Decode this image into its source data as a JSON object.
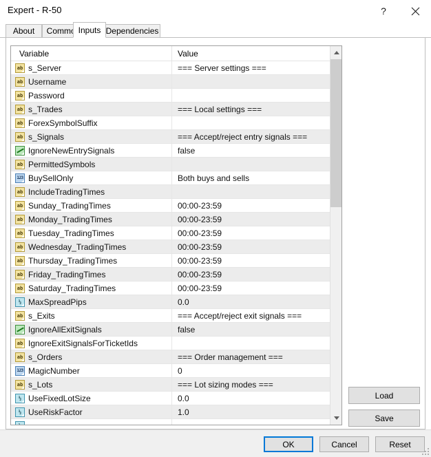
{
  "window": {
    "title": "Expert - R-50",
    "help_label": "?",
    "close_label": "✕",
    "help_icon": "question-mark-icon",
    "close_icon": "close-icon"
  },
  "tabs": [
    {
      "label": "About",
      "active": false
    },
    {
      "label": "Common",
      "active": false
    },
    {
      "label": "Inputs",
      "active": true
    },
    {
      "label": "Dependencies",
      "active": false
    }
  ],
  "list": {
    "columns": [
      "Variable",
      "Value"
    ],
    "rows": [
      {
        "type": "string",
        "name": "s_Server",
        "value": "=== Server settings ==="
      },
      {
        "type": "string",
        "name": "Username",
        "value": ""
      },
      {
        "type": "string",
        "name": "Password",
        "value": ""
      },
      {
        "type": "string",
        "name": "s_Trades",
        "value": "=== Local settings ==="
      },
      {
        "type": "string",
        "name": "ForexSymbolSuffix",
        "value": ""
      },
      {
        "type": "string",
        "name": "s_Signals",
        "value": "=== Accept/reject entry signals ==="
      },
      {
        "type": "bool",
        "name": "IgnoreNewEntrySignals",
        "value": "false"
      },
      {
        "type": "string",
        "name": "PermittedSymbols",
        "value": ""
      },
      {
        "type": "int",
        "name": "BuySellOnly",
        "value": "Both buys and sells"
      },
      {
        "type": "string",
        "name": "IncludeTradingTimes",
        "value": ""
      },
      {
        "type": "string",
        "name": "Sunday_TradingTimes",
        "value": "00:00-23:59"
      },
      {
        "type": "string",
        "name": "Monday_TradingTimes",
        "value": "00:00-23:59"
      },
      {
        "type": "string",
        "name": "Tuesday_TradingTimes",
        "value": "00:00-23:59"
      },
      {
        "type": "string",
        "name": "Wednesday_TradingTimes",
        "value": "00:00-23:59"
      },
      {
        "type": "string",
        "name": "Thursday_TradingTimes",
        "value": "00:00-23:59"
      },
      {
        "type": "string",
        "name": "Friday_TradingTimes",
        "value": "00:00-23:59"
      },
      {
        "type": "string",
        "name": "Saturday_TradingTimes",
        "value": "00:00-23:59"
      },
      {
        "type": "double",
        "name": "MaxSpreadPips",
        "value": "0.0"
      },
      {
        "type": "string",
        "name": "s_Exits",
        "value": "=== Accept/reject exit signals ==="
      },
      {
        "type": "bool",
        "name": "IgnoreAllExitSignals",
        "value": "false"
      },
      {
        "type": "string",
        "name": "IgnoreExitSignalsForTicketIds",
        "value": ""
      },
      {
        "type": "string",
        "name": "s_Orders",
        "value": "=== Order management ==="
      },
      {
        "type": "int",
        "name": "MagicNumber",
        "value": "0"
      },
      {
        "type": "string",
        "name": "s_Lots",
        "value": "=== Lot sizing modes ==="
      },
      {
        "type": "double",
        "name": "UseFixedLotSize",
        "value": "0.0"
      },
      {
        "type": "double",
        "name": "UseRiskFactor",
        "value": "1.0"
      },
      {
        "type": "double",
        "name": "",
        "value": ""
      }
    ],
    "icon_labels": {
      "string": "ab",
      "int": "123",
      "double": "½",
      "bool": ""
    }
  },
  "scrollbar": {
    "up_label": "scroll-up",
    "down_label": "scroll-down"
  },
  "side_buttons": {
    "load": "Load",
    "save": "Save"
  },
  "footer_buttons": {
    "ok": "OK",
    "cancel": "Cancel",
    "reset": "Reset"
  },
  "colors": {
    "accent": "#0078d7",
    "row_alt": "#ececec",
    "scroll_thumb": "#cdcdcd",
    "tab_border": "#bfbfbf"
  }
}
